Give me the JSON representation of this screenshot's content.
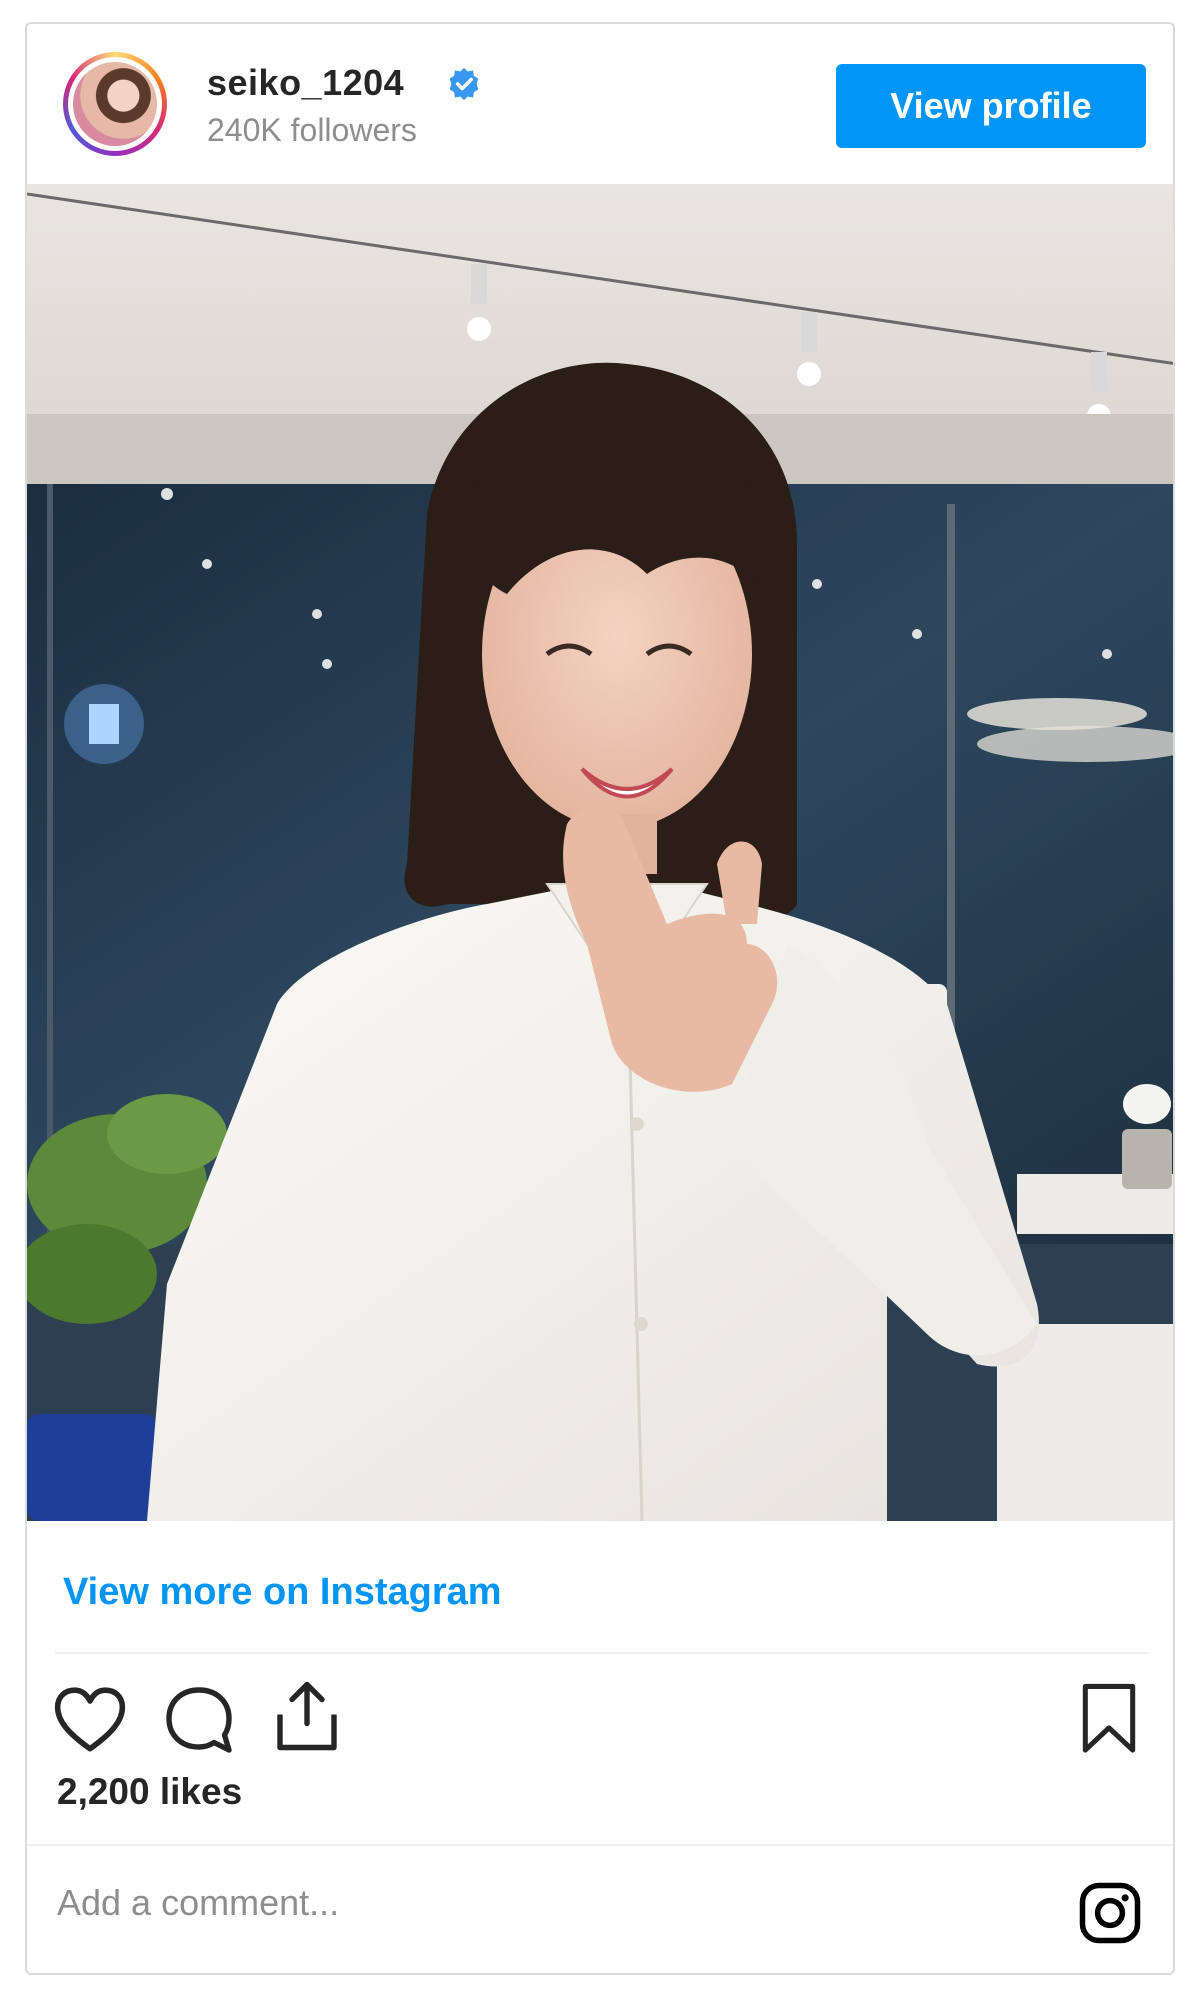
{
  "post": {
    "username": "seiko_1204",
    "verified": true,
    "followers": "240K followers",
    "view_profile_label": "View profile",
    "view_more_label": "View more on Instagram",
    "likes": "2,200 likes",
    "comment_placeholder": "Add a comment..."
  },
  "icons": {
    "like": "heart-icon",
    "comment": "comment-icon",
    "share": "share-icon",
    "save": "bookmark-icon",
    "brand": "instagram-icon"
  },
  "colors": {
    "accent": "#0095f6",
    "text": "#262626",
    "muted": "#8e8e8e",
    "border": "#dbdbdb"
  }
}
